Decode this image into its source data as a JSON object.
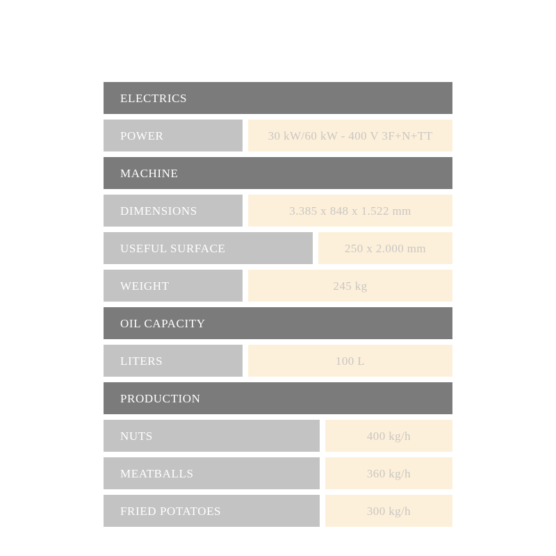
{
  "table": {
    "sections": [
      {
        "id": "electrics",
        "title": "ELECTRICS",
        "rows": [
          {
            "label": "POWER",
            "value": "30 kW/60 kW - 400 V 3F+N+TT",
            "label_width": "narrow"
          }
        ]
      },
      {
        "id": "machine",
        "title": "MACHINE",
        "rows": [
          {
            "label": "DIMENSIONS",
            "value": "3.385 x 848 x 1.522 mm",
            "label_width": "narrow"
          },
          {
            "label": "USEFUL SURFACE",
            "value": "250 x 2.000 mm",
            "label_width": "medium"
          },
          {
            "label": "WEIGHT",
            "value": "245 kg",
            "label_width": "narrow"
          }
        ]
      },
      {
        "id": "oil-capacity",
        "title": "OIL CAPACITY",
        "rows": [
          {
            "label": "LITERS",
            "value": "100 L",
            "label_width": "narrow"
          }
        ]
      },
      {
        "id": "production",
        "title": "PRODUCTION",
        "rows": [
          {
            "label": "NUTS",
            "value": "400 kg/h",
            "label_width": "wide"
          },
          {
            "label": "MEATBALLS",
            "value": "360 kg/h",
            "label_width": "wide"
          },
          {
            "label": "FRIED POTATOES",
            "value": "300 kg/h",
            "label_width": "wide"
          }
        ]
      }
    ]
  },
  "colors": {
    "section_header_bg": "#7b7b7b",
    "label_bg": "#c3c3c3",
    "value_bg": "#fdf0da",
    "header_text": "#ffffff",
    "label_text": "#ffffff",
    "value_text": "#c9c6c2",
    "page_bg": "#ffffff"
  }
}
